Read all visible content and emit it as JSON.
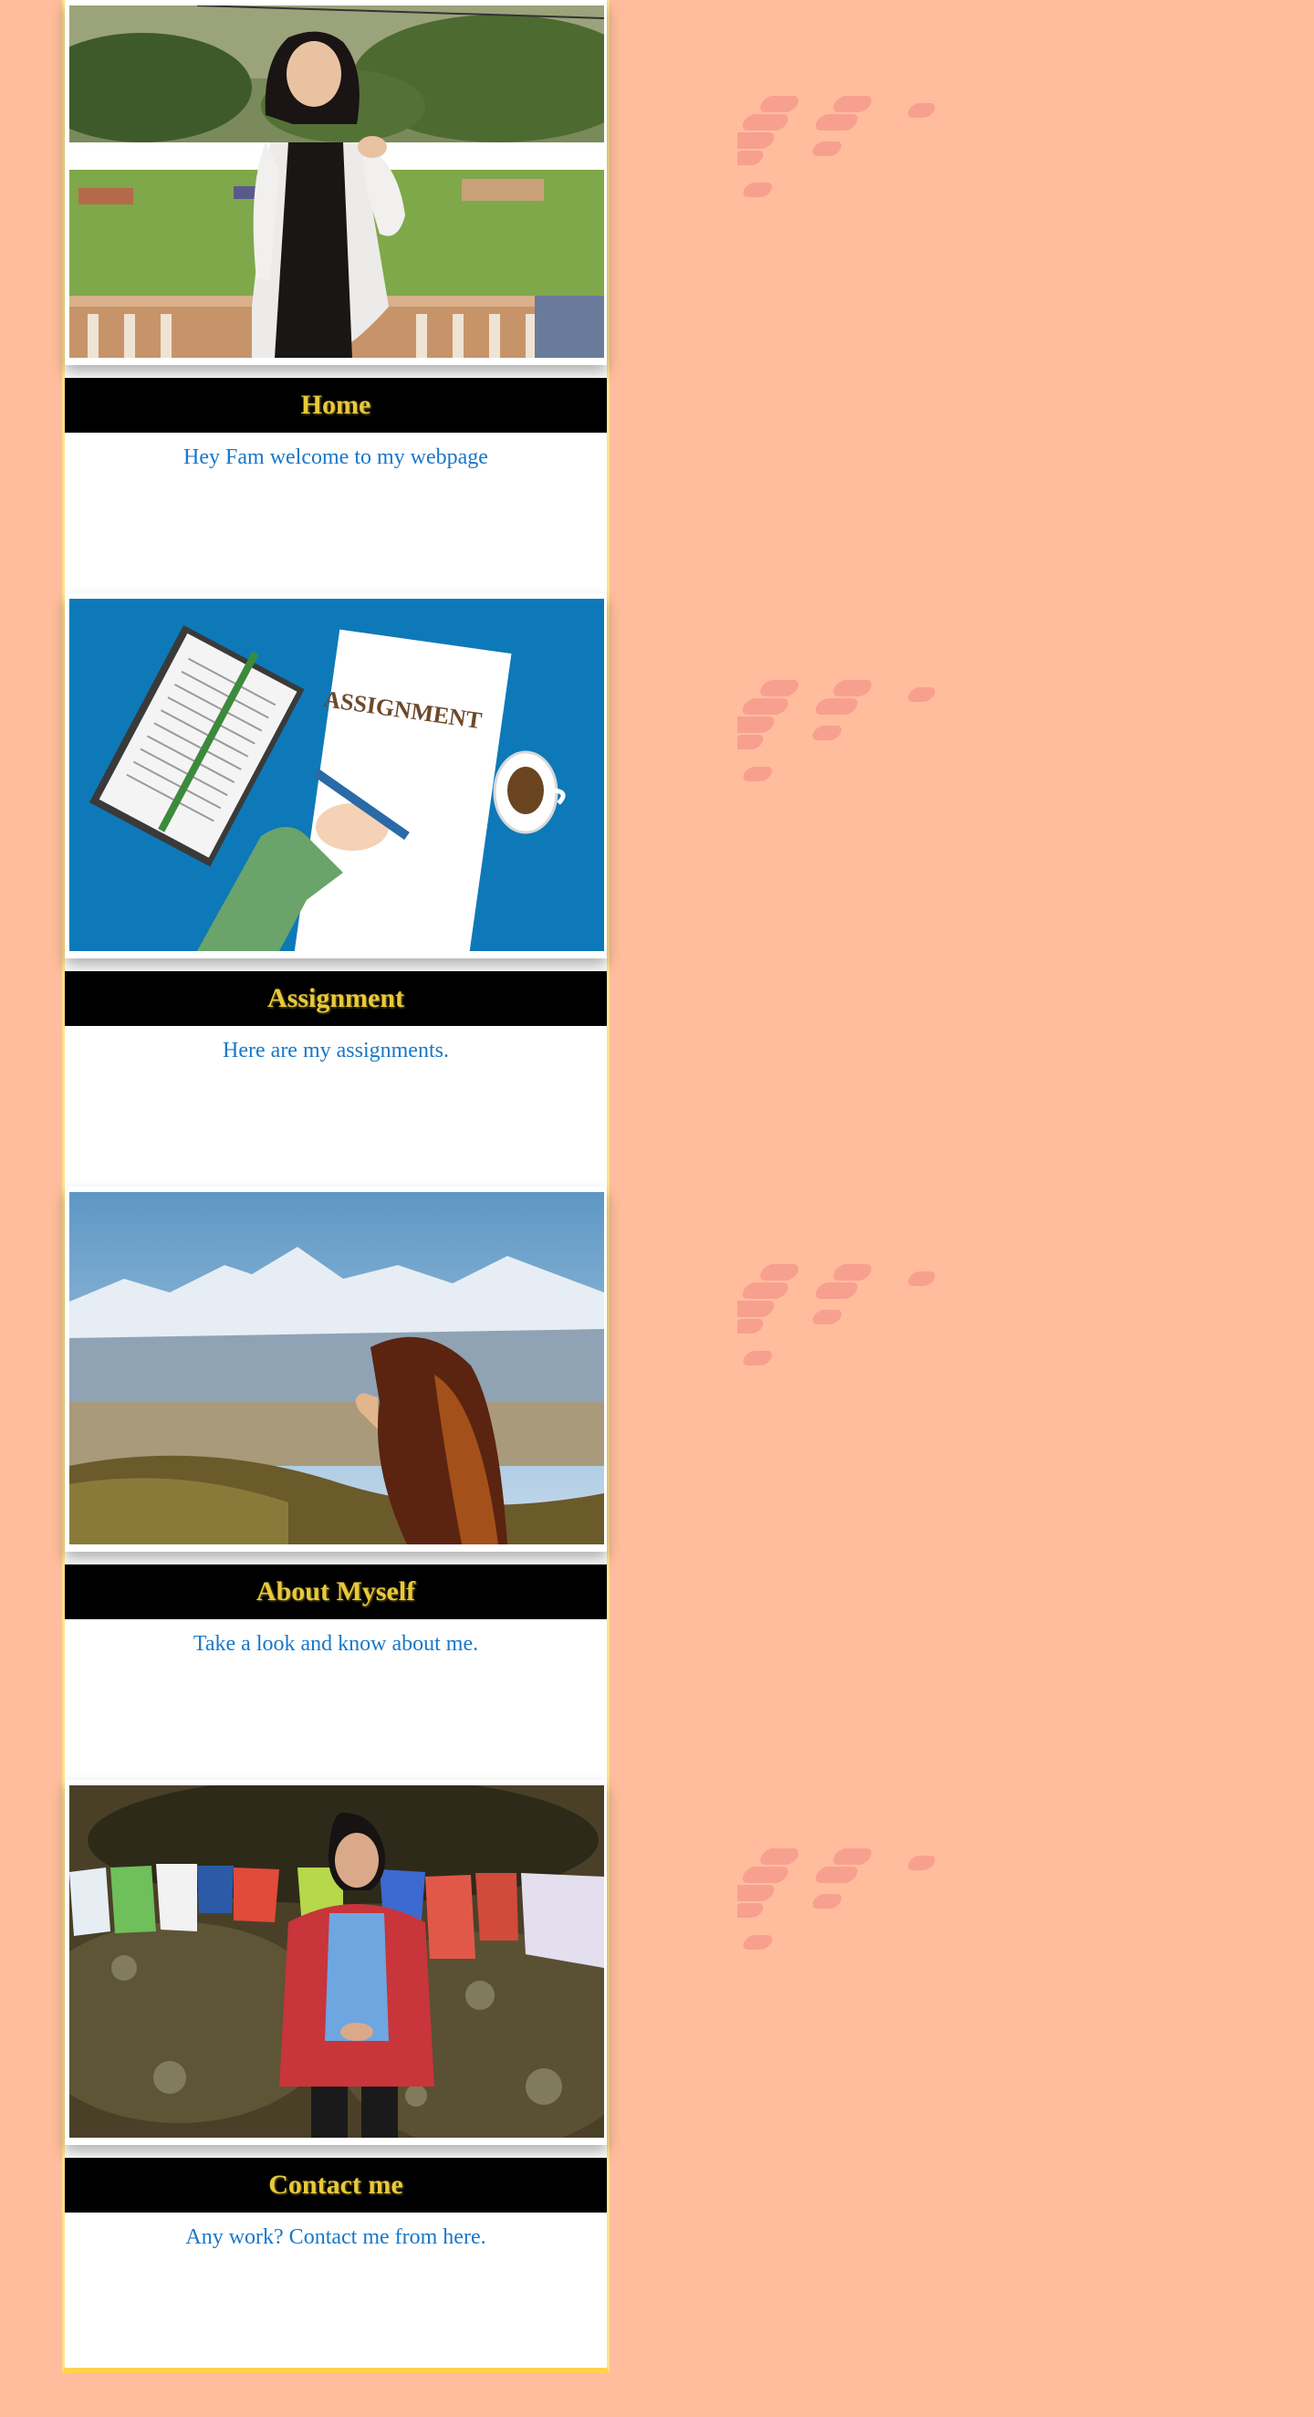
{
  "cards": [
    {
      "title": "Home",
      "caption": "Hey Fam welcome to my webpage",
      "image": "girl-in-white-jacket-on-terrace-photo"
    },
    {
      "title": "Assignment",
      "caption": "Here are my assignments.",
      "image": "assignment-illustration",
      "image_text": "ASSIGNMENT"
    },
    {
      "title": "About Myself",
      "caption": "Take a look and know about me.",
      "image": "girl-facing-mountains-photo"
    },
    {
      "title": "Contact me",
      "caption": "Any work? Contact me from here.",
      "image": "girl-with-prayer-flags-photo"
    }
  ],
  "colors": {
    "background": "#FFBD9D",
    "title_bar": "#000000",
    "title_text": "#E8C93A",
    "caption_text": "#1877C9",
    "card_border": "#FFE38A",
    "decoration": "#F28A84"
  }
}
